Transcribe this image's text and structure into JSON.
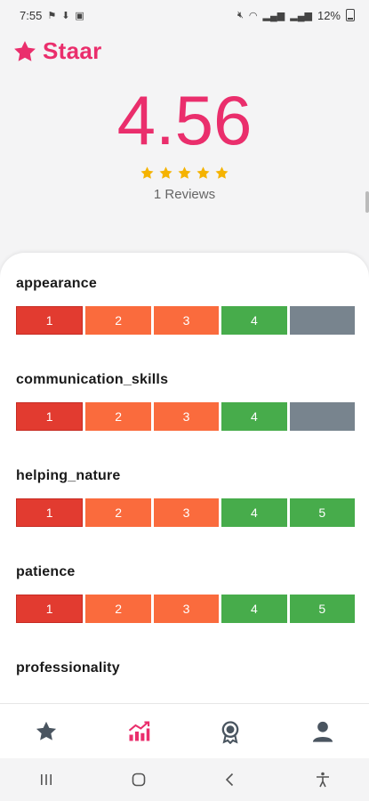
{
  "status_bar": {
    "time": "7:55",
    "battery": "12%"
  },
  "header": {
    "app_name": "Staar"
  },
  "summary": {
    "rating": "4.56",
    "stars": 5,
    "reviews_label": "1 Reviews"
  },
  "criteria": [
    {
      "name": "appearance",
      "scale": [
        "1",
        "2",
        "3",
        "4",
        ""
      ],
      "rating": 4
    },
    {
      "name": "communication_skills",
      "scale": [
        "1",
        "2",
        "3",
        "4",
        ""
      ],
      "rating": 4
    },
    {
      "name": "helping_nature",
      "scale": [
        "1",
        "2",
        "3",
        "4",
        "5"
      ],
      "rating": 5
    },
    {
      "name": "patience",
      "scale": [
        "1",
        "2",
        "3",
        "4",
        "5"
      ],
      "rating": 5
    },
    {
      "name": "professionality"
    }
  ],
  "bottom_nav": {
    "items": [
      {
        "icon": "star-icon",
        "active": false
      },
      {
        "icon": "chart-icon",
        "active": true
      },
      {
        "icon": "award-icon",
        "active": false
      },
      {
        "icon": "user-icon",
        "active": false
      }
    ]
  },
  "colors": {
    "accent": "#ea2e6c",
    "level_1": "#e23b30",
    "level_2_3": "#fa6b3d",
    "level_4_5": "#47ac4b",
    "inactive": "#78848e",
    "star_gold": "#f5b301"
  }
}
